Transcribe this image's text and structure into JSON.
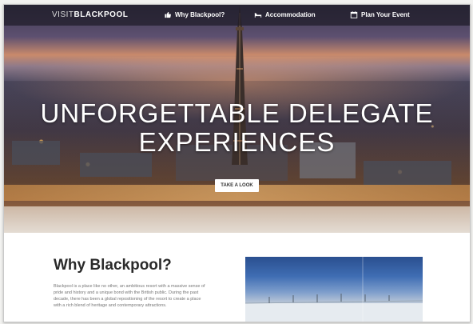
{
  "nav": {
    "logo_light": "VISIT",
    "logo_bold": "BLACKPOOL",
    "items": [
      {
        "label": "Why Blackpool?",
        "icon": "thumbs-up-icon"
      },
      {
        "label": "Accommodation",
        "icon": "bed-icon"
      },
      {
        "label": "Plan Your Event",
        "icon": "calendar-icon"
      }
    ]
  },
  "hero": {
    "title_line1": "UNFORGETTABLE DELEGATE",
    "title_line2": "EXPERIENCES",
    "button_label": "TAKE A LOOK"
  },
  "section": {
    "title": "Why Blackpool?",
    "body": "Blackpool is a place like no other, an ambitious resort with a massive sense of pride and history and a unique bond with the British public. During the past decade, there has been a global repositioning of the resort to create a place with a rich blend of heritage and contemporary attractions."
  }
}
